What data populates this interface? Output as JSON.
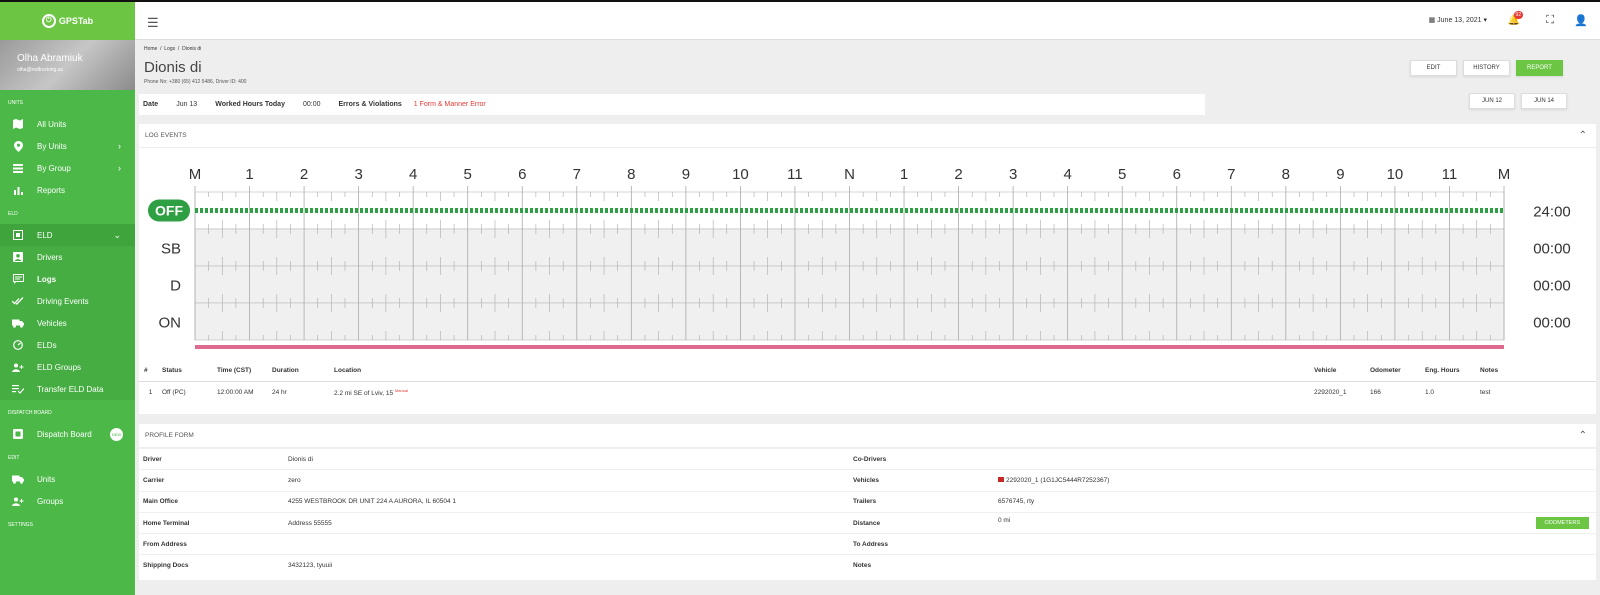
{
  "app": {
    "logo_text": "GPSTab"
  },
  "user": {
    "name": "Olha Abramiuk",
    "email": "olha@redtrucking.us"
  },
  "sidebar": {
    "units_header": "UNITS",
    "units_items": [
      "All Units",
      "By Units",
      "By Group",
      "Reports"
    ],
    "eld_header": "ELD",
    "eld_group": "ELD",
    "eld_items": [
      "Drivers",
      "Logs",
      "Driving Events",
      "Vehicles",
      "ELDs",
      "ELD Groups",
      "Transfer ELD Data"
    ],
    "dispatch_header": "DISPATCH BOARD",
    "dispatch_item": "Dispatch Board",
    "dispatch_badge": "NEW",
    "edit_header": "EDIT",
    "edit_items": [
      "Units",
      "Groups"
    ],
    "settings_header": "SETTINGS"
  },
  "topbar": {
    "date": "June 13, 2021",
    "notifications": "92"
  },
  "breadcrumb": [
    "Home",
    "Logs",
    "Dionis di"
  ],
  "page": {
    "title": "Dionis di",
    "subtitle": "Phone No: +380 (65) 412 5486, Driver ID: 400"
  },
  "actions": {
    "edit": "EDIT",
    "history": "HISTORY",
    "report": "REPORT",
    "prev_day": "JUN 12",
    "next_day": "JUN 14"
  },
  "info": {
    "date_label": "Date",
    "date": "Jun 13",
    "hours_label": "Worked Hours Today",
    "hours": "00:00",
    "errors_label": "Errors & Violations",
    "errors": "1 Form & Manner Error"
  },
  "log_events": {
    "title": "LOG EVENTS",
    "hour_labels": [
      "M",
      "1",
      "2",
      "3",
      "4",
      "5",
      "6",
      "7",
      "8",
      "9",
      "10",
      "11",
      "N",
      "1",
      "2",
      "3",
      "4",
      "5",
      "6",
      "7",
      "8",
      "9",
      "10",
      "11",
      "M"
    ],
    "rows": [
      {
        "status": "OFF",
        "total": "24:00"
      },
      {
        "status": "SB",
        "total": "00:00"
      },
      {
        "status": "D",
        "total": "00:00"
      },
      {
        "status": "ON",
        "total": "00:00"
      }
    ],
    "columns": [
      "#",
      "Status",
      "Time (CST)",
      "Duration",
      "Location",
      "Vehicle",
      "Odometer",
      "Eng. Hours",
      "Notes"
    ],
    "events": [
      {
        "num": "1",
        "status": "Off (PC)",
        "time": "12:00:00 AM",
        "duration": "24 hr",
        "location": "2.2 mi SE of Lviv, 15",
        "tag": "Manual",
        "vehicle": "2292020_1",
        "odometer": "166",
        "eng_hours": "1.0",
        "notes": "test"
      }
    ]
  },
  "profile": {
    "title": "PROFILE FORM",
    "left": [
      {
        "label": "Driver",
        "value": "Dionis di"
      },
      {
        "label": "Carrier",
        "value": "zero"
      },
      {
        "label": "Main Office",
        "value": "4255 WESTBROOK DR UNIT 224 A AURORA, IL 60504 1"
      },
      {
        "label": "Home Terminal",
        "value": "Address 55555"
      },
      {
        "label": "From Address",
        "value": ""
      },
      {
        "label": "Shipping Docs",
        "value": "3432123, tyuuii"
      }
    ],
    "right": [
      {
        "label": "Co-Drivers",
        "value": ""
      },
      {
        "label": "Vehicles",
        "value": "2292020_1 (1G1JC5444R7252367)"
      },
      {
        "label": "Trailers",
        "value": "6576745, rty"
      },
      {
        "label": "Distance",
        "value": "0 mi"
      },
      {
        "label": "To Address",
        "value": ""
      },
      {
        "label": "Notes",
        "value": ""
      }
    ],
    "odometers_button": "ODOMETERS"
  },
  "colors": {
    "brand": "#4cb848",
    "off_line": "#2ea043",
    "error": "#e53935",
    "violation_bar": "#e06b90"
  }
}
